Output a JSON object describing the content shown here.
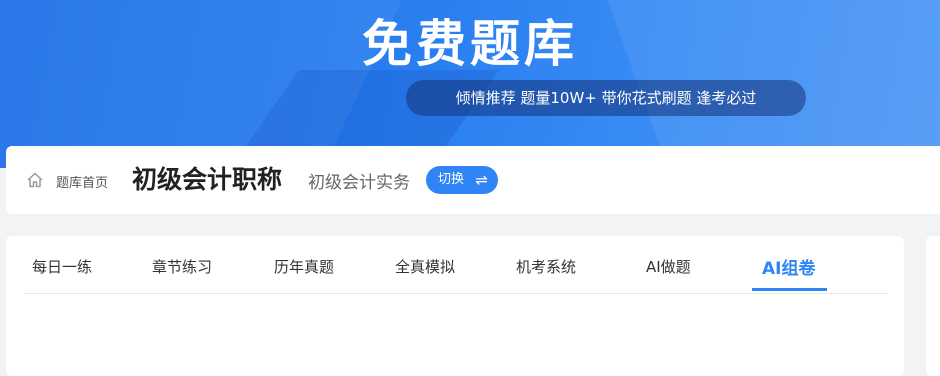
{
  "banner": {
    "title": "免费题库",
    "slogan": "倾情推荐 题量10W+ 带你花式刷题 逢考必过"
  },
  "info": {
    "home_label": "题库首页",
    "exam_title": "初级会计职称",
    "subject": "初级会计实务",
    "switch_label": "切换",
    "switch_icon": "⇌"
  },
  "tabs": [
    {
      "label": "每日一练"
    },
    {
      "label": "章节练习"
    },
    {
      "label": "历年真题"
    },
    {
      "label": "全真模拟"
    },
    {
      "label": "机考系统"
    },
    {
      "label": "AI做题"
    },
    {
      "label": "AI组卷"
    }
  ],
  "colors": {
    "accent": "#2f85f5",
    "banner": "#1e6fe8"
  }
}
